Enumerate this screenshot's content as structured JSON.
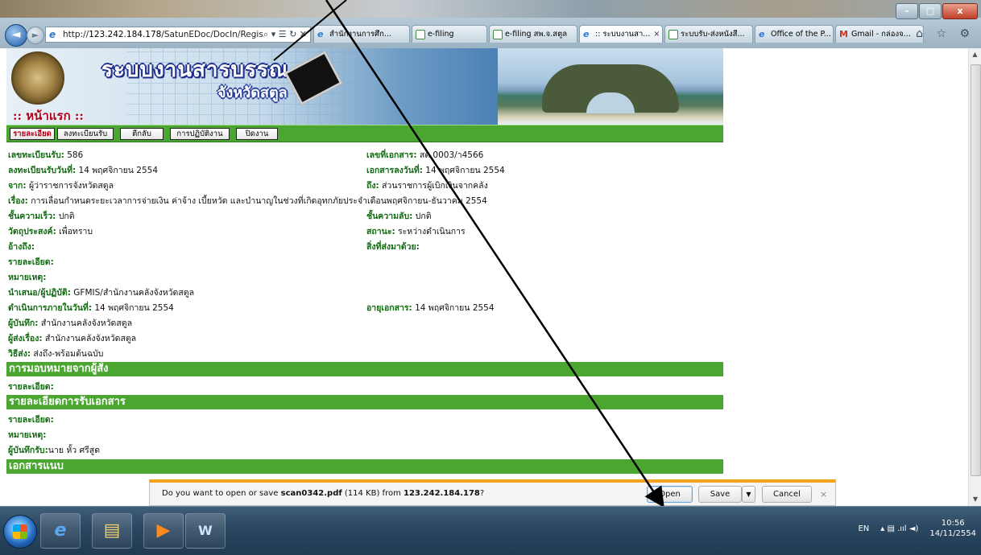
{
  "browser": {
    "url_prefix": "http://",
    "url_host": "123.242.184.178",
    "url_path": "/SatunEDoc/DocIn/Regisl",
    "addr_tools": "⌕ ▾ ☰ ↻ ✕",
    "tabs": [
      {
        "label": "สำนักงานการศึก...",
        "icon": "ie-icon"
      },
      {
        "label": "e-filing",
        "icon": "mail-icon"
      },
      {
        "label": "e-filing สพ.จ.สตูล",
        "icon": "mail-icon"
      },
      {
        "label": ":: ระบบงานสา...",
        "icon": "ie-icon",
        "active": true
      },
      {
        "label": "ระบบรับ-ส่งหนังสื...",
        "icon": "mail-icon"
      },
      {
        "label": "Office of the P...",
        "icon": "ie-icon"
      },
      {
        "label": "Gmail - กล่องจ...",
        "icon": "gmail-icon"
      }
    ],
    "tab_close": "×",
    "right_icons": "⌂ ☆ ⚙"
  },
  "banner": {
    "title": "ระบบงานสารบรรณ",
    "subtitle": "จังหวัดสตูล",
    "home_link": ":: หน้าแรก ::"
  },
  "menu": [
    "รายละเอียด",
    "ลงทะเบียนรับ",
    "ตีกลับ",
    "การปฏิบัติงาน",
    "ปิดงาน"
  ],
  "details": {
    "reg_no": {
      "label": "เลขทะเบียนรับ:",
      "value": " 586"
    },
    "doc_no": {
      "label": "เลขที่เอกสาร:",
      "value": " สต 0003/า4566"
    },
    "reg_date": {
      "label": "ลงทะเบียนรับวันที่:",
      "value": " 14 พฤศจิกายน 2554"
    },
    "doc_date": {
      "label": "เอกสารลงวันที่:",
      "value": " 14 พฤศจิกายน 2554"
    },
    "from": {
      "label": "จาก:",
      "value": " ผู้ว่าราชการจังหวัดสตูล"
    },
    "to": {
      "label": "ถึง:",
      "value": " ส่วนราชการผู้เบิกเงินจากคลัง"
    },
    "subject": {
      "label": "เรื่อง:",
      "value": " การเลื่อนกำหนดระยะเวลาการจ่ายเงิน  ค่าจ้าง  เบี้ยหวัด  และบำนาญในช่วงที่เกิดอุทกภัยประจำเดือนพฤศจิกายน-ธันวาคม  2554"
    },
    "urgency": {
      "label": "ชั้นความเร็ว:",
      "value": " ปกติ"
    },
    "secrecy": {
      "label": "ชั้นความลับ:",
      "value": " ปกติ"
    },
    "purpose": {
      "label": "วัตถุประสงค์:",
      "value": " เพื่อทราบ"
    },
    "status": {
      "label": "สถานะ:",
      "value": " ระหว่างดำเนินการ"
    },
    "reference": {
      "label": "อ้างถึง:",
      "value": ""
    },
    "enclosure": {
      "label": "สิ่งที่ส่งมาด้วย:",
      "value": ""
    },
    "detail": {
      "label": "รายละเอียด:",
      "value": ""
    },
    "remark": {
      "label": "หมายเหตุ:",
      "value": ""
    },
    "proposer": {
      "label": "นำเสนอ/ผู้ปฏิบัติ:",
      "value": " GFMIS/สำนักงานคลังจังหวัดสตูล"
    },
    "due": {
      "label": "ดำเนินการภายในวันที่:",
      "value": " 14 พฤศจิกายน  2554"
    },
    "age": {
      "label": "อายุเอกสาร:",
      "value": " 14 พฤศจิกายน  2554"
    },
    "recorder": {
      "label": "ผู้บันทึก:",
      "value": " สำนักงานคลังจังหวัดสตูล"
    },
    "sender": {
      "label": "ผู้ส่งเรื่อง:",
      "value": " สำนักงานคลังจังหวัดสตูล"
    },
    "method": {
      "label": "วิธีส่ง:",
      "value": " ส่งถึง-พร้อมต้นฉบับ"
    }
  },
  "sections": {
    "assign": {
      "title": "การมอบหมายจากผู้สั่ง",
      "detail_label": "รายละเอียด:"
    },
    "receive": {
      "title": "รายละเอียดการรับเอกสาร",
      "detail_label": "รายละเอียด:",
      "remark_label": "หมายเหตุ:",
      "receiver_label": "ผู้บันทึกรับ:",
      "receiver_value": "นาย  หั้ว  ศรีสูด"
    },
    "attachments": {
      "title": "เอกสารแนบ"
    }
  },
  "download": {
    "prompt_pre": "Do you want to open or save ",
    "filename": "scan0342.pdf",
    "size": " (114 KB) from ",
    "host": "123.242.184.178",
    "prompt_post": "?",
    "open_label": "Open",
    "save_label": "Save",
    "save_dropdown": "▼",
    "cancel_label": "Cancel",
    "close_label": "×"
  },
  "taskbar": {
    "lang": "EN",
    "tray_symbols": "▴  ▤  .ııl  ◄)",
    "time": "10:56",
    "date": "14/11/2554"
  },
  "window_controls": {
    "minimize": "–",
    "maximize": "□",
    "close": "x"
  },
  "colors": {
    "section_green": "#4aa631",
    "label_green": "#146b14",
    "download_bar_accent": "#f2a31b"
  }
}
